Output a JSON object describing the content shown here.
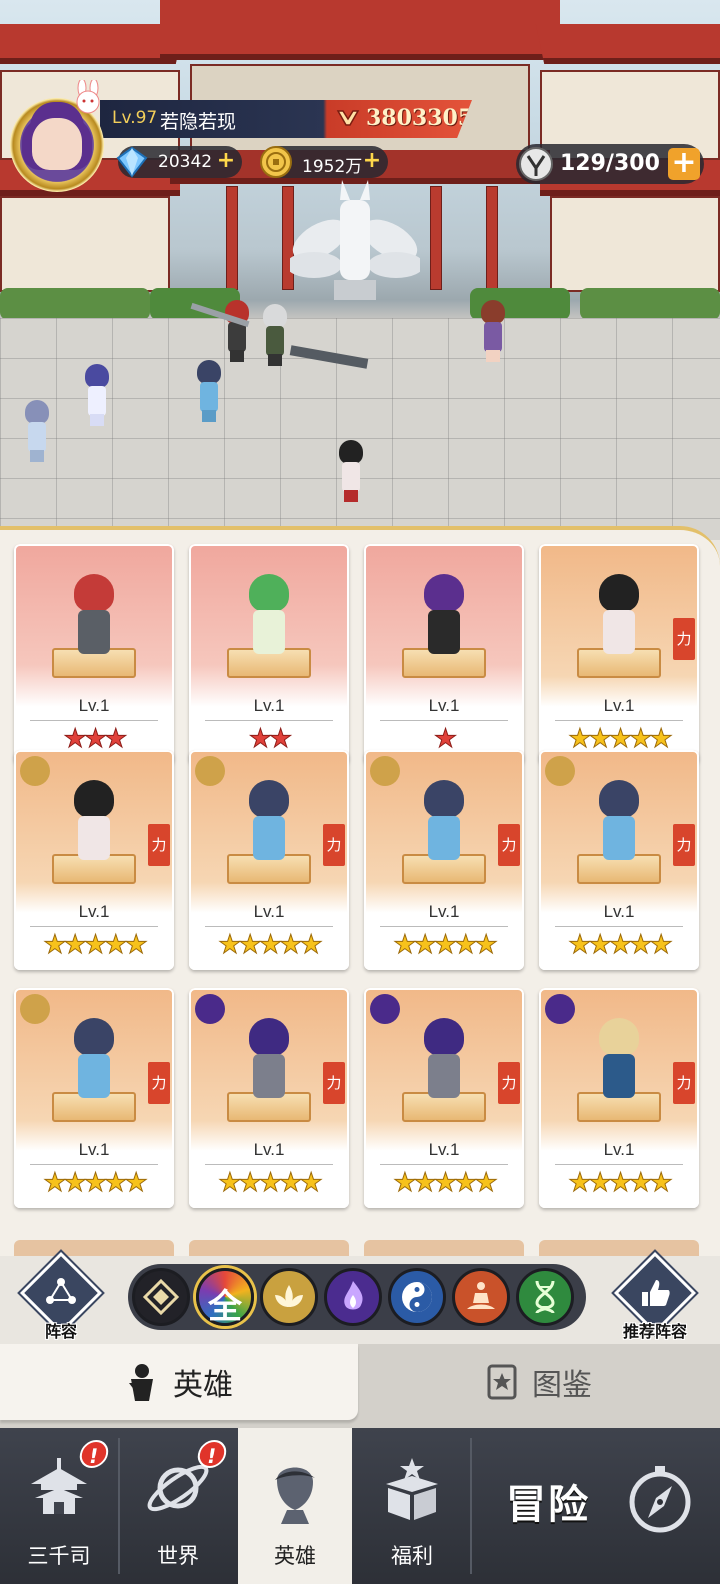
{
  "player": {
    "level": "Lv.97",
    "name": "若隐若现",
    "power": "3803305"
  },
  "resources": {
    "diamonds": "20342",
    "gold": "1952万",
    "stamina": "129/300"
  },
  "cards": [
    {
      "level": "Lv.1",
      "stars": "★★★",
      "star_color": "red",
      "rarity": "r1"
    },
    {
      "level": "Lv.1",
      "stars": "★★",
      "star_color": "red",
      "rarity": "r1"
    },
    {
      "level": "Lv.1",
      "stars": "★",
      "star_color": "red",
      "rarity": "r1"
    },
    {
      "level": "Lv.1",
      "stars": "★★★★★",
      "star_color": "gold",
      "rarity": "r2",
      "tag": "力"
    },
    {
      "level": "Lv.1",
      "stars": "★★★★★",
      "star_color": "gold",
      "rarity": "r2",
      "tag": "力",
      "faction": "lotus"
    },
    {
      "level": "Lv.1",
      "stars": "★★★★★",
      "star_color": "gold",
      "rarity": "r2",
      "tag": "力",
      "faction": "lotus"
    },
    {
      "level": "Lv.1",
      "stars": "★★★★★",
      "star_color": "gold",
      "rarity": "r2",
      "tag": "力",
      "faction": "lotus"
    },
    {
      "level": "Lv.1",
      "stars": "★★★★★",
      "star_color": "gold",
      "rarity": "r2",
      "tag": "力",
      "faction": "lotus"
    },
    {
      "level": "Lv.1",
      "stars": "★★★★★",
      "star_color": "gold",
      "rarity": "r2",
      "tag": "力",
      "faction": "lotus"
    },
    {
      "level": "Lv.1",
      "stars": "★★★★★",
      "star_color": "gold",
      "rarity": "r2",
      "tag": "力",
      "faction": "flame"
    },
    {
      "level": "Lv.1",
      "stars": "★★★★★",
      "star_color": "gold",
      "rarity": "r2",
      "tag": "力",
      "faction": "flame"
    },
    {
      "level": "Lv.1",
      "stars": "★★★★★",
      "star_color": "gold",
      "rarity": "r2",
      "tag": "力",
      "faction": "flame"
    }
  ],
  "filter": {
    "formation_label": "阵容",
    "recommend_label": "推荐阵容",
    "all_label": "全",
    "factions": [
      "diamond-icon",
      "all",
      "lotus-icon",
      "flame-icon",
      "taiji-icon",
      "meditation-icon",
      "dna-icon"
    ],
    "faction_colors": [
      "#222228",
      "#d88a1c",
      "#c9a13f",
      "#4b2c8f",
      "#2b5ba6",
      "#c9522a",
      "#2f8a3e"
    ]
  },
  "subtabs": {
    "heroes": "英雄",
    "codex": "图鉴"
  },
  "nav": {
    "items": [
      "三千司",
      "世界",
      "英雄",
      "福利"
    ],
    "adventure": "冒险",
    "alert_mark": "!"
  }
}
